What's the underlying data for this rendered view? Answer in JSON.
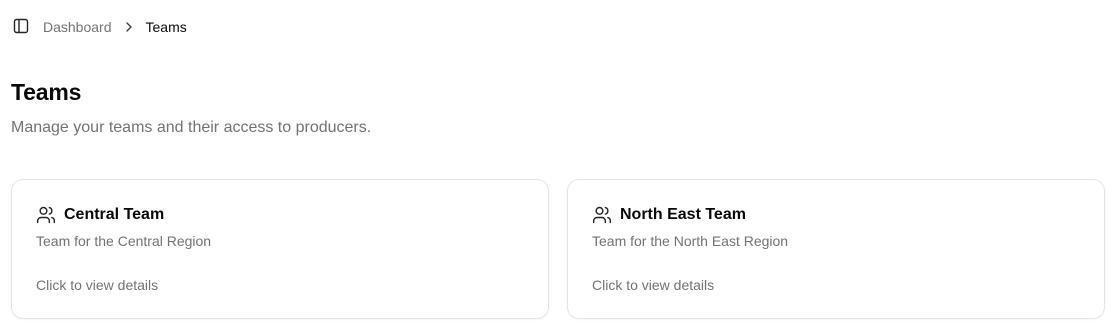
{
  "breadcrumb": {
    "items": [
      {
        "label": "Dashboard"
      },
      {
        "label": "Teams"
      }
    ]
  },
  "header": {
    "title": "Teams",
    "subtitle": "Manage your teams and their access to producers."
  },
  "teams": [
    {
      "name": "Central Team",
      "description": "Team for the Central Region",
      "hint": "Click to view details",
      "icon": "users-icon"
    },
    {
      "name": "North East Team",
      "description": "Team for the North East Region",
      "hint": "Click to view details",
      "icon": "users-icon"
    }
  ],
  "colors": {
    "text_primary": "#0a0a0a",
    "text_muted": "#737373",
    "border": "#e5e5e5",
    "background": "#ffffff"
  }
}
